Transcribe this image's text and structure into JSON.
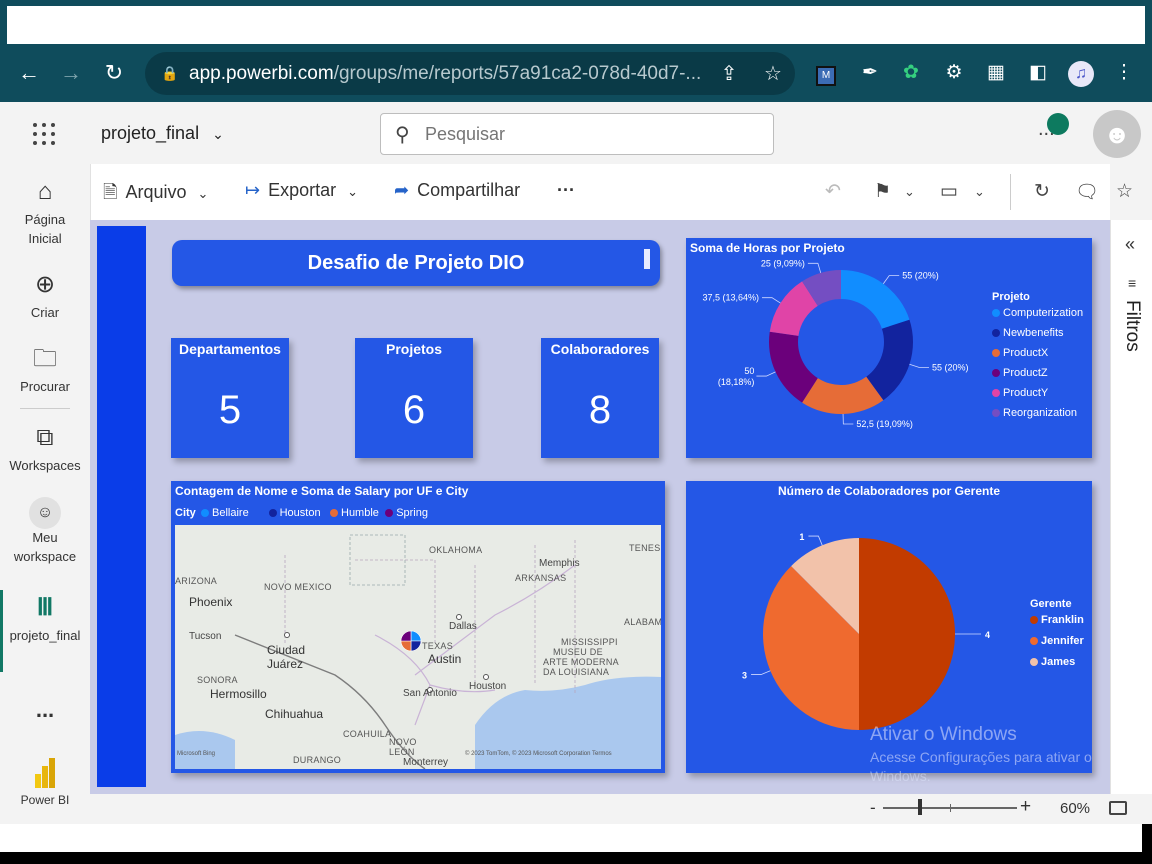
{
  "browser": {
    "url_host": "app.powerbi.com",
    "url_path": "/groups/me/reports/57a91ca2-078d-40d7-..."
  },
  "header": {
    "report_name": "projeto_final",
    "search_placeholder": "Pesquisar",
    "more": "..."
  },
  "leftnav": {
    "items": [
      {
        "label": "Página Inicial",
        "icon": "home-icon"
      },
      {
        "label": "Criar",
        "icon": "plus-circle-icon"
      },
      {
        "label": "Procurar",
        "icon": "folder-icon"
      },
      {
        "label": "Workspaces",
        "icon": "workspaces-icon"
      },
      {
        "label": "Meu workspace",
        "icon": "user-icon"
      },
      {
        "label": "projeto_final",
        "icon": "report-icon"
      }
    ],
    "more": "...",
    "app_label": "Power BI"
  },
  "ribbon": {
    "file": "Arquivo",
    "export": "Exportar",
    "share": "Compartilhar",
    "more": "···"
  },
  "side_panel": {
    "label": "Filtros"
  },
  "zoom": {
    "value": "60%",
    "minus": "-",
    "plus": "+",
    "level": 0.6
  },
  "report": {
    "title": "Desafio de Projeto DIO",
    "cards": [
      {
        "label": "Departamentos",
        "value": "5"
      },
      {
        "label": "Projetos",
        "value": "6"
      },
      {
        "label": "Colaboradores",
        "value": "8"
      }
    ]
  },
  "donut": {
    "title": "Soma de Horas por Projeto",
    "legend_title": "Projeto",
    "slices": [
      {
        "name": "Computerization",
        "value": 55,
        "label": "55 (20%)",
        "color": "#118dff"
      },
      {
        "name": "Newbenefits",
        "value": 55,
        "label": "55 (20%)",
        "color": "#12239e"
      },
      {
        "name": "ProductX",
        "value": 52.5,
        "label": "52,5 (19,09%)",
        "color": "#e66c37"
      },
      {
        "name": "ProductZ",
        "value": 50,
        "label": "50 (18,18%)",
        "color": "#6b007b"
      },
      {
        "name": "ProductY",
        "value": 37.5,
        "label": "37,5 (13,64%)",
        "color": "#e044a7"
      },
      {
        "name": "Reorganization",
        "value": 25,
        "label": "25 (9,09%)",
        "color": "#744ec2"
      }
    ]
  },
  "map": {
    "title": "Contagem de Nome e Soma de Salary por UF e City",
    "legend_title": "City",
    "legend": [
      {
        "name": "Bellaire",
        "color": "#118dff"
      },
      {
        "name": "Houston",
        "color": "#12239e"
      },
      {
        "name": "Humble",
        "color": "#e66c37"
      },
      {
        "name": "Spring",
        "color": "#6b007b"
      }
    ],
    "labels": {
      "oklahoma": "OKLAHOMA",
      "tenness": "TENESS",
      "memphis": "Memphis",
      "arizona": "ARIZONA",
      "novo_mexico": "NOVO MEXICO",
      "arkansas": "ARKANSAS",
      "phoenix": "Phoenix",
      "dallas": "Dallas",
      "tucson": "Tucson",
      "mississippi": "MISSISSIPPI",
      "alabam": "ALABAM",
      "ciudad": "Ciudad",
      "juarez": "Juárez",
      "texas": "TEXAS",
      "austin": "Austin",
      "museu": "MUSEU DE",
      "arte": "ARTE MODERNA",
      "louisiana": "DA LOUISIANA",
      "sonora": "SONORA",
      "hermosillo": "Hermosillo",
      "san_antonio": "San Antonio",
      "houston": "Houston",
      "chihuahua": "Chihuahua",
      "coahuila": "COAHUILA",
      "novo_leon": "NOVO",
      "leon": "LEÓN",
      "durango": "DURANGO",
      "monterrey": "Monterrey",
      "copyright": "© 2023 TomTom, © 2023 Microsoft Corporation Termos",
      "bing": "Microsoft Bing"
    }
  },
  "pie": {
    "title": "Número de Colaboradores por Gerente",
    "legend_title": "Gerente",
    "slices": [
      {
        "name": "Franklin",
        "value": 4,
        "label": "4",
        "color": "#c23b00"
      },
      {
        "name": "Jennifer",
        "value": 3,
        "label": "3",
        "color": "#ef6a2f"
      },
      {
        "name": "James",
        "value": 1,
        "label": "1",
        "color": "#f2c2aa"
      }
    ]
  },
  "watermark": {
    "line1": "Ativar o Windows",
    "line2": "Acesse Configurações para ativar o",
    "line3": "Windows."
  }
}
